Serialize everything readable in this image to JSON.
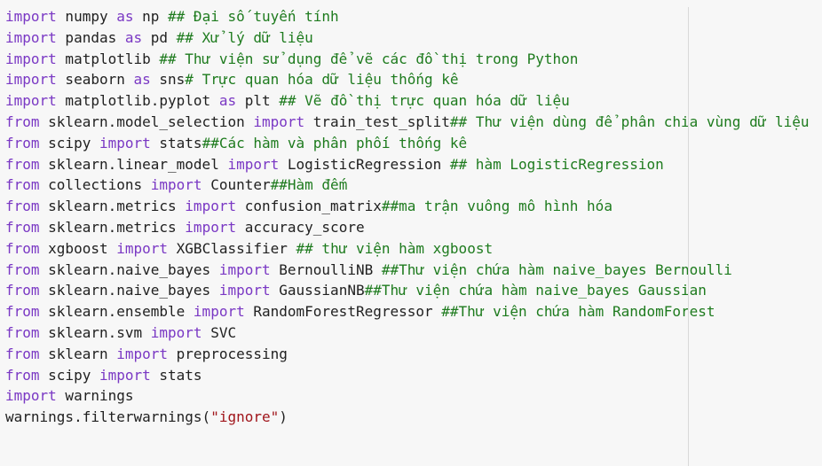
{
  "colors": {
    "background": "#f7f7f7",
    "keyword": "#7a38c4",
    "comment": "#1e7b1e",
    "string": "#a0151b",
    "text": "#212121"
  },
  "code_lines": [
    [
      {
        "t": "kw",
        "v": "import"
      },
      {
        "t": "tx",
        "v": " numpy "
      },
      {
        "t": "kw",
        "v": "as"
      },
      {
        "t": "tx",
        "v": " np "
      },
      {
        "t": "cm",
        "v": "## Đại số tuyến tính"
      }
    ],
    [
      {
        "t": "kw",
        "v": "import"
      },
      {
        "t": "tx",
        "v": " pandas "
      },
      {
        "t": "kw",
        "v": "as"
      },
      {
        "t": "tx",
        "v": " pd "
      },
      {
        "t": "cm",
        "v": "## Xử lý dữ liệu"
      }
    ],
    [
      {
        "t": "kw",
        "v": "import"
      },
      {
        "t": "tx",
        "v": " matplotlib "
      },
      {
        "t": "cm",
        "v": "## Thư viện sử dụng để vẽ các đồ thị trong Python"
      }
    ],
    [
      {
        "t": "kw",
        "v": "import"
      },
      {
        "t": "tx",
        "v": " seaborn "
      },
      {
        "t": "kw",
        "v": "as"
      },
      {
        "t": "tx",
        "v": " sns"
      },
      {
        "t": "cm",
        "v": "# Trực quan hóa dữ liệu thống kê"
      }
    ],
    [
      {
        "t": "kw",
        "v": "import"
      },
      {
        "t": "tx",
        "v": " matplotlib.pyplot "
      },
      {
        "t": "kw",
        "v": "as"
      },
      {
        "t": "tx",
        "v": " plt "
      },
      {
        "t": "cm",
        "v": "## Vẽ đồ thị trực quan hóa dữ liệu"
      }
    ],
    [
      {
        "t": "kw",
        "v": "from"
      },
      {
        "t": "tx",
        "v": " sklearn.model_selection "
      },
      {
        "t": "kw",
        "v": "import"
      },
      {
        "t": "tx",
        "v": " train_test_split"
      },
      {
        "t": "cm",
        "v": "## Thư viện dùng để phân chia vùng dữ liệu"
      }
    ],
    [
      {
        "t": "kw",
        "v": "from"
      },
      {
        "t": "tx",
        "v": " scipy "
      },
      {
        "t": "kw",
        "v": "import"
      },
      {
        "t": "tx",
        "v": " stats"
      },
      {
        "t": "cm",
        "v": "##Các hàm và phân phối thống kê"
      }
    ],
    [
      {
        "t": "kw",
        "v": "from"
      },
      {
        "t": "tx",
        "v": " sklearn.linear_model "
      },
      {
        "t": "kw",
        "v": "import"
      },
      {
        "t": "tx",
        "v": " LogisticRegression "
      },
      {
        "t": "cm",
        "v": "## hàm LogisticRegression"
      }
    ],
    [
      {
        "t": "kw",
        "v": "from"
      },
      {
        "t": "tx",
        "v": " collections "
      },
      {
        "t": "kw",
        "v": "import"
      },
      {
        "t": "tx",
        "v": " Counter"
      },
      {
        "t": "cm",
        "v": "##Hàm đếm"
      }
    ],
    [
      {
        "t": "kw",
        "v": "from"
      },
      {
        "t": "tx",
        "v": " sklearn.metrics "
      },
      {
        "t": "kw",
        "v": "import"
      },
      {
        "t": "tx",
        "v": " confusion_matrix"
      },
      {
        "t": "cm",
        "v": "##ma trận vuông mô hình hóa"
      }
    ],
    [
      {
        "t": "kw",
        "v": "from"
      },
      {
        "t": "tx",
        "v": " sklearn.metrics "
      },
      {
        "t": "kw",
        "v": "import"
      },
      {
        "t": "tx",
        "v": " accuracy_score"
      }
    ],
    [
      {
        "t": "kw",
        "v": "from"
      },
      {
        "t": "tx",
        "v": " xgboost "
      },
      {
        "t": "kw",
        "v": "import"
      },
      {
        "t": "tx",
        "v": " XGBClassifier "
      },
      {
        "t": "cm",
        "v": "## thư viện hàm xgboost"
      }
    ],
    [
      {
        "t": "kw",
        "v": "from"
      },
      {
        "t": "tx",
        "v": " sklearn.naive_bayes "
      },
      {
        "t": "kw",
        "v": "import"
      },
      {
        "t": "tx",
        "v": " BernoulliNB "
      },
      {
        "t": "cm",
        "v": "##Thư viện chứa hàm naive_bayes Bernoulli"
      }
    ],
    [
      {
        "t": "kw",
        "v": "from"
      },
      {
        "t": "tx",
        "v": " sklearn.naive_bayes "
      },
      {
        "t": "kw",
        "v": "import"
      },
      {
        "t": "tx",
        "v": " GaussianNB"
      },
      {
        "t": "cm",
        "v": "##Thư viện chứa hàm naive_bayes Gaussian"
      }
    ],
    [
      {
        "t": "kw",
        "v": "from"
      },
      {
        "t": "tx",
        "v": " sklearn.ensemble "
      },
      {
        "t": "kw",
        "v": "import"
      },
      {
        "t": "tx",
        "v": " RandomForestRegressor "
      },
      {
        "t": "cm",
        "v": "##Thư viện chứa hàm RandomForest"
      }
    ],
    [
      {
        "t": "kw",
        "v": "from"
      },
      {
        "t": "tx",
        "v": " sklearn.svm "
      },
      {
        "t": "kw",
        "v": "import"
      },
      {
        "t": "tx",
        "v": " SVC"
      }
    ],
    [
      {
        "t": "kw",
        "v": "from"
      },
      {
        "t": "tx",
        "v": " sklearn "
      },
      {
        "t": "kw",
        "v": "import"
      },
      {
        "t": "tx",
        "v": " preprocessing"
      }
    ],
    [
      {
        "t": "kw",
        "v": "from"
      },
      {
        "t": "tx",
        "v": " scipy "
      },
      {
        "t": "kw",
        "v": "import"
      },
      {
        "t": "tx",
        "v": " stats"
      }
    ],
    [
      {
        "t": "kw",
        "v": "import"
      },
      {
        "t": "tx",
        "v": " warnings"
      }
    ],
    [
      {
        "t": "tx",
        "v": "warnings.filterwarnings("
      },
      {
        "t": "st",
        "v": "\"ignore\""
      },
      {
        "t": "tx",
        "v": ")"
      }
    ]
  ]
}
